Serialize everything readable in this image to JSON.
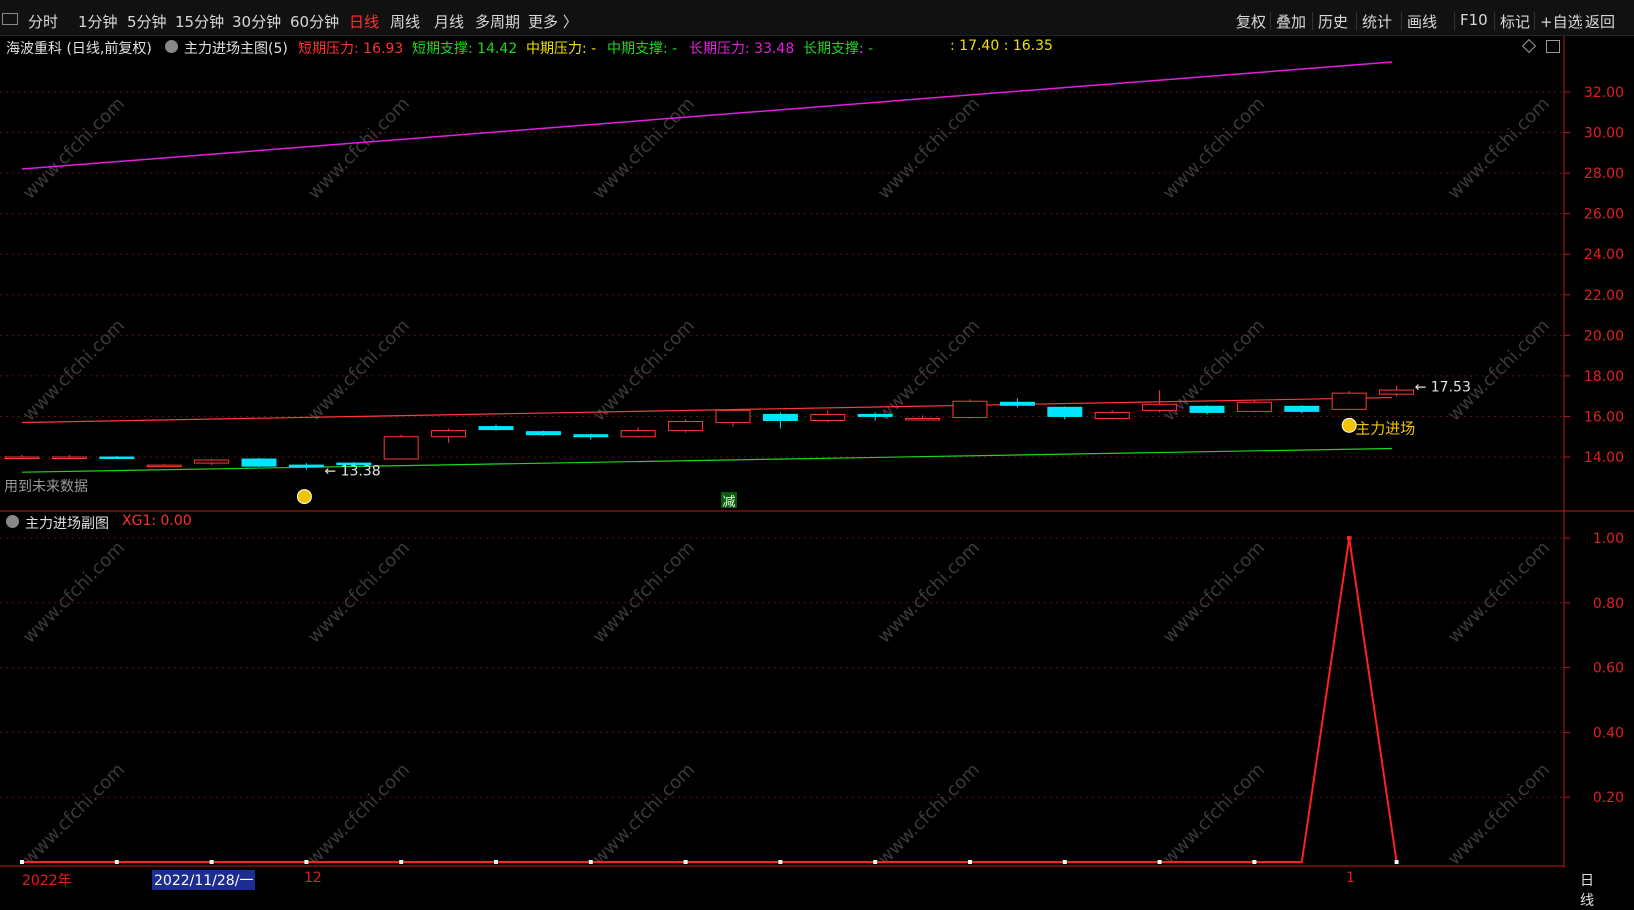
{
  "toolbar": {
    "periods": [
      "分时",
      "1分钟",
      "5分钟",
      "15分钟",
      "30分钟",
      "60分钟",
      "日线",
      "周线",
      "月线",
      "多周期",
      "更多 〉"
    ],
    "active_period": "日线",
    "right_buttons": [
      "复权",
      "叠加",
      "历史",
      "统计",
      "画线",
      "F10",
      "标记",
      "+自选",
      "返回"
    ]
  },
  "main": {
    "stock_title": "海波重科 (日线,前复权)",
    "indicator_name": "主力进场主图(5)",
    "short_pressure": "短期压力: 16.93",
    "short_support": "短期支撑: 14.42",
    "mid_pressure": "中期压力: -",
    "mid_support": "中期支撑: -",
    "long_pressure": "长期压力: 33.48",
    "long_support": "长期支撑: -",
    "extra": ": 17.40 : 16.35",
    "future_data_note": "用到未来数据",
    "low_marker": "13.38",
    "high_marker": "17.53",
    "signal_label": "主力进场",
    "reduce_badge": "减",
    "y_labels": [
      "32.00",
      "30.00",
      "28.00",
      "26.00",
      "24.00",
      "22.00",
      "20.00",
      "18.00",
      "16.00",
      "14.00"
    ]
  },
  "sub": {
    "indicator_name": "主力进场副图",
    "xg1": "XG1: 0.00",
    "y_labels": [
      "1.00",
      "0.80",
      "0.60",
      "0.40",
      "0.20"
    ]
  },
  "datebar": {
    "year": "2022年",
    "cursor_date": "2022/11/28/一",
    "month_12": "12",
    "month_1": "1",
    "period_label": "日线"
  },
  "watermark": "www.cfchi.com",
  "colors": {
    "up": "#ff3a3a",
    "down": "#00e5ff",
    "green_line": "#1fd61f",
    "magenta_line": "#e020e0",
    "axis": "#c01818",
    "signal": "#f0c400"
  },
  "chart_data": {
    "type": "candlestick",
    "price_range": [
      12.6,
      33.8
    ],
    "candles": [
      {
        "o": 14.0,
        "c": 14.0,
        "h": 14.1,
        "l": 13.9
      },
      {
        "o": 14.0,
        "c": 14.0,
        "h": 14.1,
        "l": 13.9
      },
      {
        "o": 14.0,
        "c": 13.95,
        "h": 14.05,
        "l": 13.9
      },
      {
        "o": 13.6,
        "c": 13.6,
        "h": 13.65,
        "l": 13.55
      },
      {
        "o": 13.7,
        "c": 13.85,
        "h": 13.9,
        "l": 13.6
      },
      {
        "o": 13.9,
        "c": 13.55,
        "h": 13.95,
        "l": 13.5
      },
      {
        "o": 13.6,
        "c": 13.55,
        "h": 13.7,
        "l": 13.38
      },
      {
        "o": 13.7,
        "c": 13.65,
        "h": 13.75,
        "l": 13.6
      },
      {
        "o": 13.9,
        "c": 15.0,
        "h": 15.1,
        "l": 13.9
      },
      {
        "o": 15.0,
        "c": 15.3,
        "h": 15.4,
        "l": 14.7
      },
      {
        "o": 15.5,
        "c": 15.35,
        "h": 15.6,
        "l": 15.3
      },
      {
        "o": 15.25,
        "c": 15.1,
        "h": 15.3,
        "l": 15.05
      },
      {
        "o": 15.1,
        "c": 15.0,
        "h": 15.15,
        "l": 14.85
      },
      {
        "o": 15.0,
        "c": 15.3,
        "h": 15.45,
        "l": 14.95
      },
      {
        "o": 15.3,
        "c": 15.75,
        "h": 15.85,
        "l": 15.2
      },
      {
        "o": 15.7,
        "c": 16.3,
        "h": 16.35,
        "l": 15.5
      },
      {
        "o": 16.1,
        "c": 15.8,
        "h": 16.2,
        "l": 15.4
      },
      {
        "o": 15.8,
        "c": 16.1,
        "h": 16.3,
        "l": 15.7
      },
      {
        "o": 16.1,
        "c": 16.0,
        "h": 16.2,
        "l": 15.8
      },
      {
        "o": 15.9,
        "c": 15.9,
        "h": 16.05,
        "l": 15.8
      },
      {
        "o": 15.95,
        "c": 16.75,
        "h": 16.85,
        "l": 15.9
      },
      {
        "o": 16.7,
        "c": 16.55,
        "h": 16.9,
        "l": 16.45
      },
      {
        "o": 16.45,
        "c": 16.0,
        "h": 16.5,
        "l": 15.85
      },
      {
        "o": 15.9,
        "c": 16.2,
        "h": 16.3,
        "l": 15.85
      },
      {
        "o": 16.3,
        "c": 16.6,
        "h": 17.3,
        "l": 16.2
      },
      {
        "o": 16.5,
        "c": 16.2,
        "h": 16.55,
        "l": 16.1
      },
      {
        "o": 16.25,
        "c": 16.7,
        "h": 16.8,
        "l": 16.2
      },
      {
        "o": 16.5,
        "c": 16.25,
        "h": 16.55,
        "l": 16.15
      },
      {
        "o": 16.35,
        "c": 17.15,
        "h": 17.25,
        "l": 16.3
      },
      {
        "o": 17.1,
        "c": 17.3,
        "h": 17.53,
        "l": 17.0
      }
    ],
    "short_pressure_line": [
      15.7,
      16.93
    ],
    "short_support_line": [
      13.25,
      14.42
    ],
    "long_pressure_line": [
      28.2,
      33.48
    ],
    "sub_series": {
      "name": "XG1",
      "values": [
        0,
        0,
        0,
        0,
        0,
        0,
        0,
        0,
        0,
        0,
        0,
        0,
        0,
        0,
        0,
        0,
        0,
        0,
        0,
        0,
        0,
        0,
        0,
        0,
        0,
        0,
        0,
        0,
        1,
        0
      ]
    },
    "sub_range": [
      0,
      1
    ]
  }
}
